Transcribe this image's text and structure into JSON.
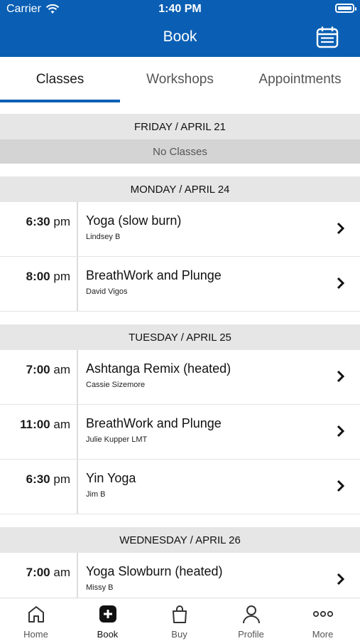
{
  "status": {
    "carrier": "Carrier",
    "time": "1:40 PM"
  },
  "header": {
    "title": "Book"
  },
  "tabs": [
    {
      "label": "Classes",
      "active": true
    },
    {
      "label": "Workshops",
      "active": false
    },
    {
      "label": "Appointments",
      "active": false
    }
  ],
  "days": [
    {
      "header": "FRIDAY / APRIL 21",
      "empty_label": "No Classes"
    },
    {
      "header": "MONDAY / APRIL 24"
    },
    {
      "header": "TUESDAY / APRIL 25"
    },
    {
      "header": "WEDNESDAY / APRIL 26"
    }
  ],
  "classes": {
    "mon": [
      {
        "time": "6:30",
        "ampm": "pm",
        "name": "Yoga (slow burn)",
        "instructor": "Lindsey B"
      },
      {
        "time": "8:00",
        "ampm": "pm",
        "name": "BreathWork and Plunge",
        "instructor": "David Vigos"
      }
    ],
    "tue": [
      {
        "time": "7:00",
        "ampm": "am",
        "name": "Ashtanga Remix (heated)",
        "instructor": "Cassie Sizemore"
      },
      {
        "time": "11:00",
        "ampm": "am",
        "name": "BreathWork and Plunge",
        "instructor": "Julie Kupper LMT"
      },
      {
        "time": "6:30",
        "ampm": "pm",
        "name": "Yin Yoga",
        "instructor": "Jim B"
      }
    ],
    "wed": [
      {
        "time": "7:00",
        "ampm": "am",
        "name": "Yoga Slowburn (heated)",
        "instructor": "Missy B"
      }
    ]
  },
  "tabbar": [
    {
      "label": "Home",
      "icon": "home-icon"
    },
    {
      "label": "Book",
      "icon": "plus-square-icon",
      "active": true
    },
    {
      "label": "Buy",
      "icon": "shopping-bag-icon"
    },
    {
      "label": "Profile",
      "icon": "person-icon"
    },
    {
      "label": "More",
      "icon": "ellipsis-icon"
    }
  ],
  "colors": {
    "brand": "#0a5fb4",
    "day_header_bg": "#e6e6e6",
    "no_classes_bg": "#d4d4d4"
  }
}
